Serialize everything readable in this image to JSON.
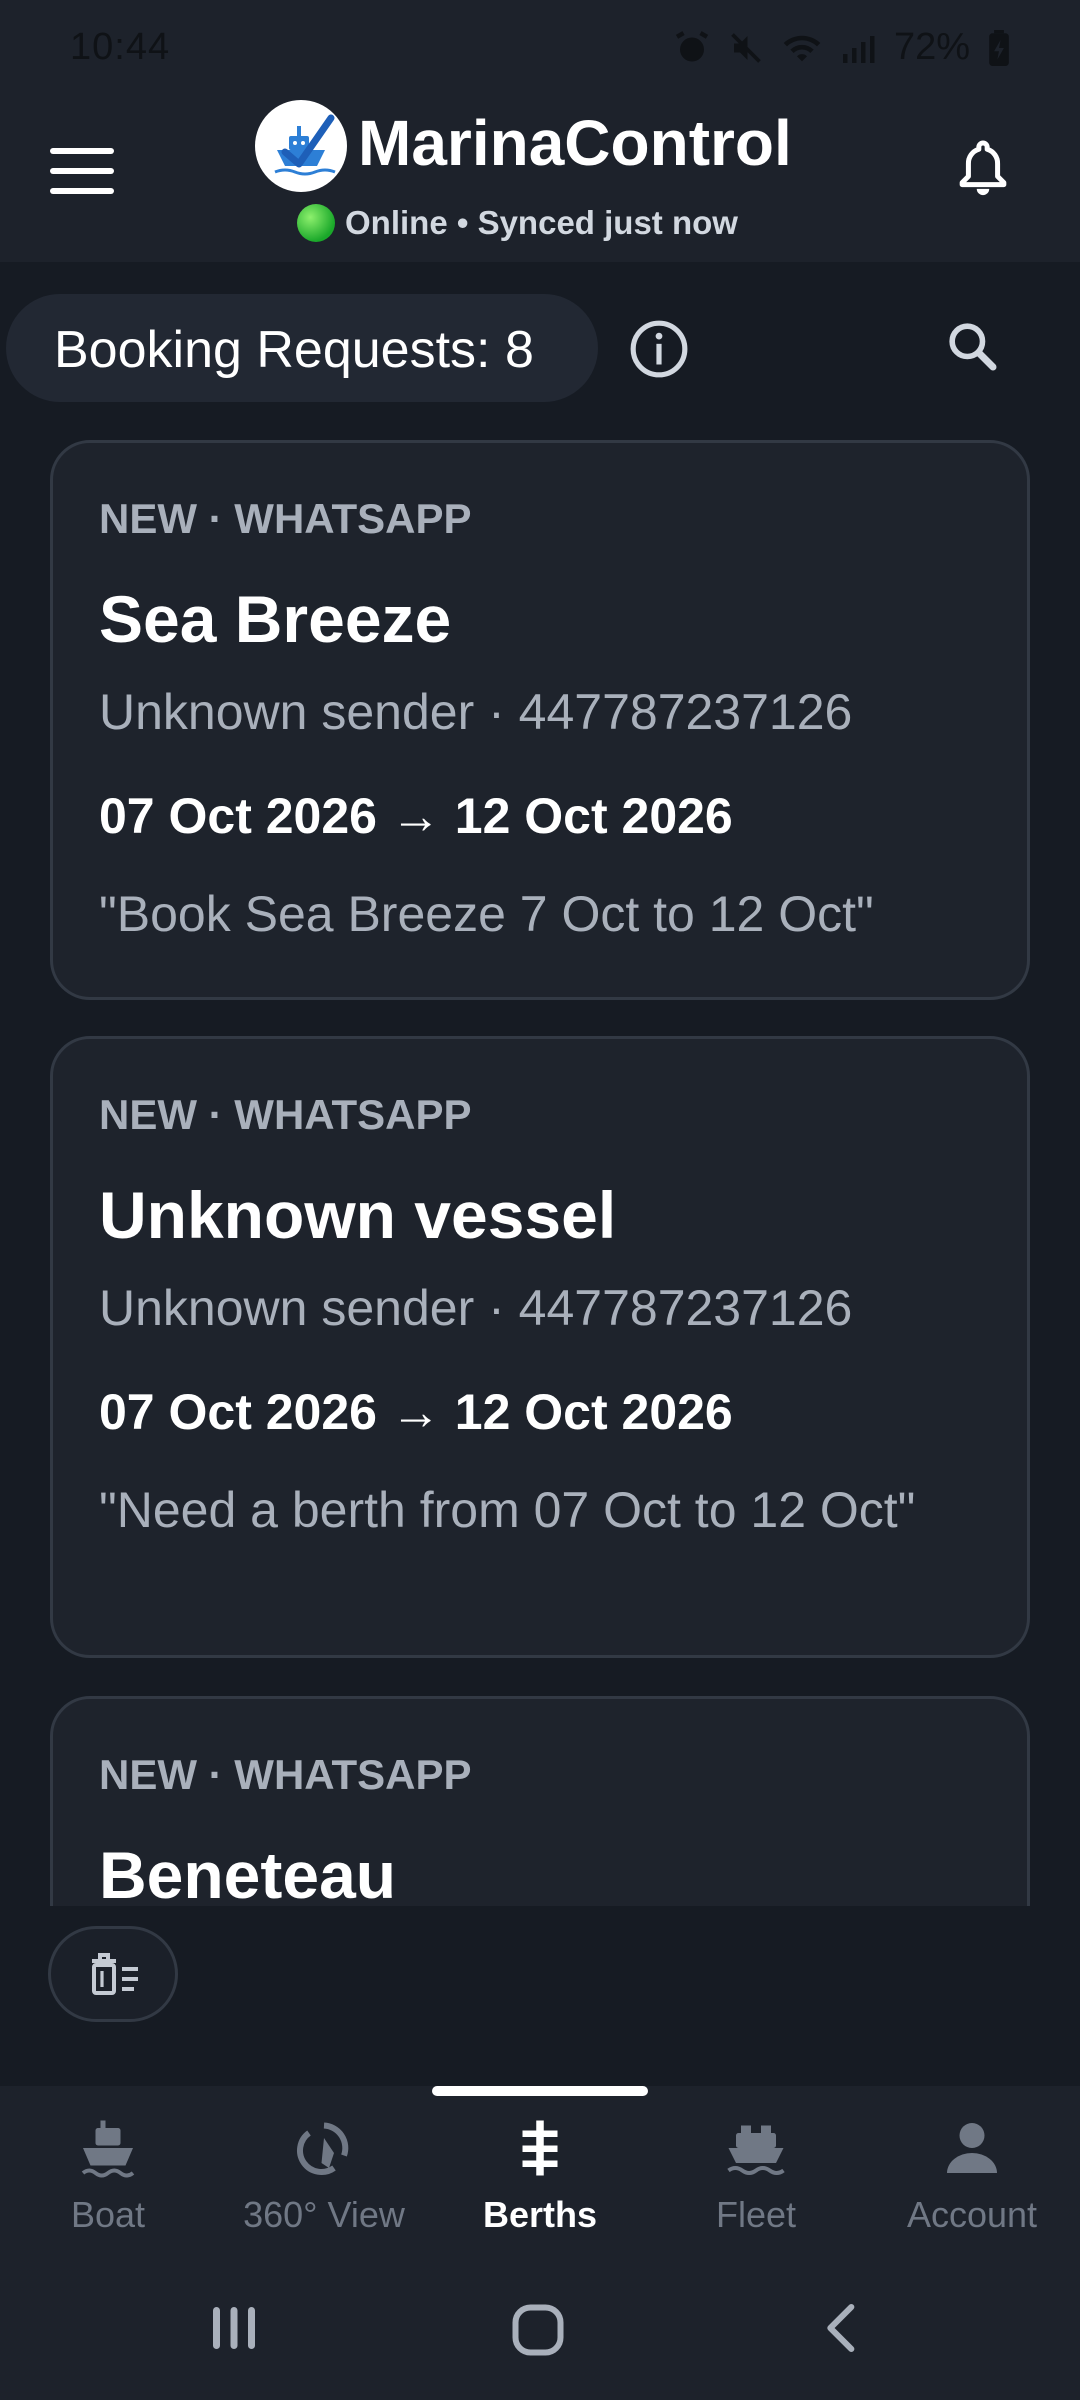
{
  "status_bar": {
    "time": "10:44",
    "battery": "72%",
    "icons": [
      "alarm-icon",
      "mute-icon",
      "wifi-icon",
      "signal-icon",
      "battery-icon"
    ]
  },
  "header": {
    "title": "MarinaControl",
    "status_online": "Online",
    "status_separator": "•",
    "status_sync": "Synced just now",
    "sync_text": "Online • Synced just now",
    "logo_icon": "boat-check-logo",
    "menu_icon": "hamburger-menu-icon",
    "bell_icon": "bell-icon"
  },
  "toolbar": {
    "requests_label": "Booking Requests: 8",
    "info_icon": "info-icon",
    "search_icon": "search-icon"
  },
  "requests": [
    {
      "tag": "NEW · WHATSAPP",
      "vessel": "Sea Breeze",
      "sender": "Unknown sender · 447787237126",
      "dates": "07 Oct 2026 → 12 Oct 2026",
      "message": "\"Book Sea Breeze 7 Oct to 12 Oct\""
    },
    {
      "tag": "NEW · WHATSAPP",
      "vessel": "Unknown vessel",
      "sender": "Unknown sender · 447787237126",
      "dates": "07 Oct 2026 → 12 Oct 2026",
      "message": "\"Need a berth from 07 Oct to 12 Oct\""
    },
    {
      "tag": "NEW · WHATSAPP",
      "vessel": "Beneteau"
    }
  ],
  "fab": {
    "icon": "clear-list-icon"
  },
  "bottom_nav": {
    "active": "Berths",
    "items": [
      {
        "label": "Boat",
        "icon": "boat-icon"
      },
      {
        "label": "360° View",
        "icon": "360-view-icon"
      },
      {
        "label": "Berths",
        "icon": "berths-icon"
      },
      {
        "label": "Fleet",
        "icon": "fleet-icon"
      },
      {
        "label": "Account",
        "icon": "account-icon"
      }
    ]
  },
  "system_nav": {
    "icons": [
      "recent-apps-icon",
      "home-icon",
      "back-icon"
    ]
  },
  "colors": {
    "background": "#161b23",
    "surface": "#1d222b",
    "card": "#1e232c",
    "card_border": "#323944",
    "text_primary": "#ffffff",
    "text_secondary": "#a9b0bb",
    "nav_inactive": "#707885",
    "online_green": "#2cc13a"
  }
}
